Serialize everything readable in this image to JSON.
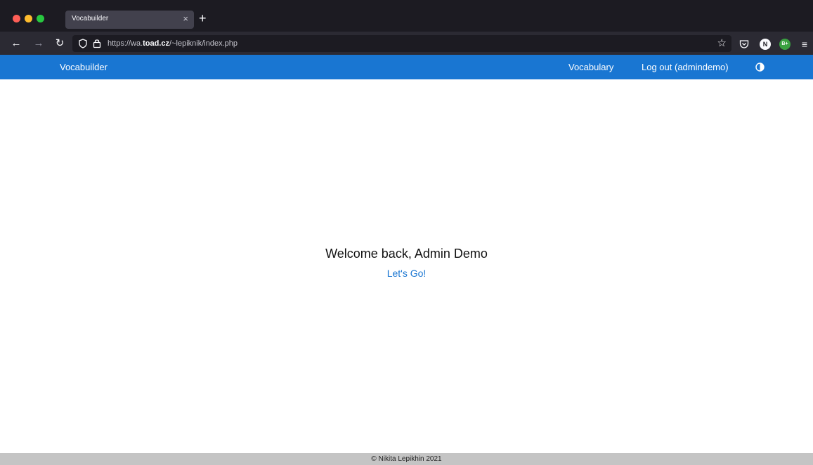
{
  "browser": {
    "tab_title": "Vocabuilder",
    "tab_close": "×",
    "new_tab": "+",
    "url_prefix": "https://wa.",
    "url_domain": "toad.cz",
    "url_path": "/~lepiknik/index.php",
    "extension_n": "N",
    "extension_b": "B+",
    "icons": {
      "back": "arrow-left-icon",
      "forward": "arrow-right-icon",
      "reload": "reload-icon",
      "shield": "shield-icon",
      "lock": "lock-icon",
      "bookmark": "star-icon",
      "pocket": "pocket-icon",
      "menu": "hamburger-menu-icon"
    }
  },
  "header": {
    "brand": "Vocabuilder",
    "nav": {
      "vocabulary": "Vocabulary",
      "logout": "Log out (admindemo)"
    },
    "theme_icon": "contrast-toggle-icon"
  },
  "main": {
    "welcome": "Welcome back, Admin Demo",
    "cta": "Let's Go!"
  },
  "footer": {
    "copyright": "© Nikita Lepikhin 2021"
  },
  "colors": {
    "header_bg": "#1976d2",
    "link": "#1976d2",
    "footer_bg": "#c4c4c4",
    "chrome_dark": "#1c1b22",
    "chrome_toolbar": "#2b2a33"
  }
}
